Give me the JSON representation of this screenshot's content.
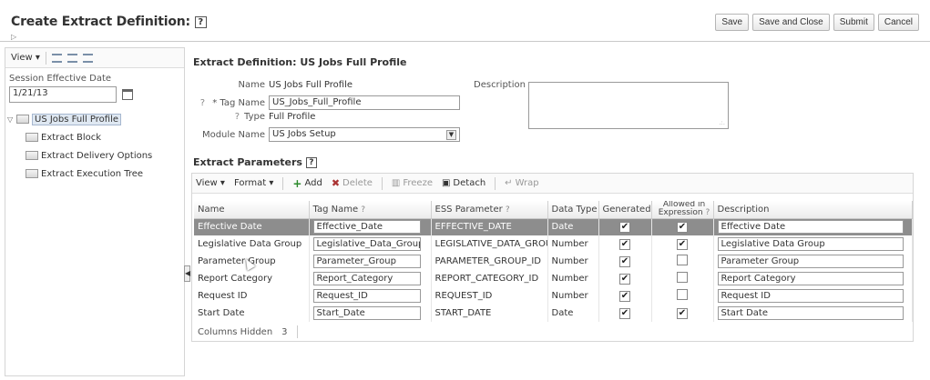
{
  "page": {
    "title": "Create Extract Definition:",
    "help": "?",
    "expand_glyph": "▷"
  },
  "actions": {
    "save": "Save",
    "save_close": "Save and Close",
    "submit": "Submit",
    "cancel": "Cancel"
  },
  "left_panel": {
    "view_label": "View ▾",
    "session_label": "Session Effective Date",
    "session_date": "1/21/13",
    "tree": [
      {
        "label": "US Jobs Full Profile",
        "expanded": true,
        "selected": true
      },
      {
        "label": "Extract Block"
      },
      {
        "label": "Extract Delivery Options"
      },
      {
        "label": "Extract Execution Tree"
      }
    ]
  },
  "definition": {
    "heading": "Extract Definition: US Jobs Full Profile",
    "name_label": "Name",
    "name_value": "US Jobs Full Profile",
    "tag_label": "* Tag Name",
    "tag_value": "US_Jobs_Full_Profile",
    "type_label": "Type",
    "type_value": "Full Profile",
    "module_label": "Module Name",
    "module_value": "US Jobs Setup",
    "description_label": "Description",
    "description_value": "",
    "help_q": "?"
  },
  "parameters": {
    "heading": "Extract Parameters",
    "toolbar": {
      "view": "View ▾",
      "format": "Format ▾",
      "add": "Add",
      "delete": "Delete",
      "freeze": "Freeze",
      "detach": "Detach",
      "wrap": "Wrap"
    },
    "columns": {
      "name": "Name",
      "tag": "Tag Name",
      "ess": "ESS Parameter",
      "dtype": "Data Type",
      "generated": "Generated",
      "allowed_line1": "Allowed in",
      "allowed_line2": "Expression",
      "description": "Description",
      "q": "?"
    },
    "rows": [
      {
        "name": "Effective Date",
        "tag": "Effective_Date",
        "ess": "EFFECTIVE_DATE",
        "dtype": "Date",
        "generated": true,
        "allowed": true,
        "desc": "Effective Date"
      },
      {
        "name": "Legislative Data Group",
        "tag": "Legislative_Data_Group",
        "ess": "LEGISLATIVE_DATA_GROUP_",
        "dtype": "Number",
        "generated": true,
        "allowed": true,
        "desc": "Legislative Data Group"
      },
      {
        "name": "Parameter Group",
        "tag": "Parameter_Group",
        "ess": "PARAMETER_GROUP_ID",
        "dtype": "Number",
        "generated": true,
        "allowed": false,
        "desc": "Parameter Group"
      },
      {
        "name": "Report Category",
        "tag": "Report_Category",
        "ess": "REPORT_CATEGORY_ID",
        "dtype": "Number",
        "generated": true,
        "allowed": false,
        "desc": "Report Category"
      },
      {
        "name": "Request ID",
        "tag": "Request_ID",
        "ess": "REQUEST_ID",
        "dtype": "Number",
        "generated": true,
        "allowed": false,
        "desc": "Request ID"
      },
      {
        "name": "Start Date",
        "tag": "Start_Date",
        "ess": "START_DATE",
        "dtype": "Date",
        "generated": true,
        "allowed": true,
        "desc": "Start Date"
      }
    ],
    "footer_label": "Columns Hidden",
    "footer_count": "3",
    "check_glyph": "✔"
  }
}
